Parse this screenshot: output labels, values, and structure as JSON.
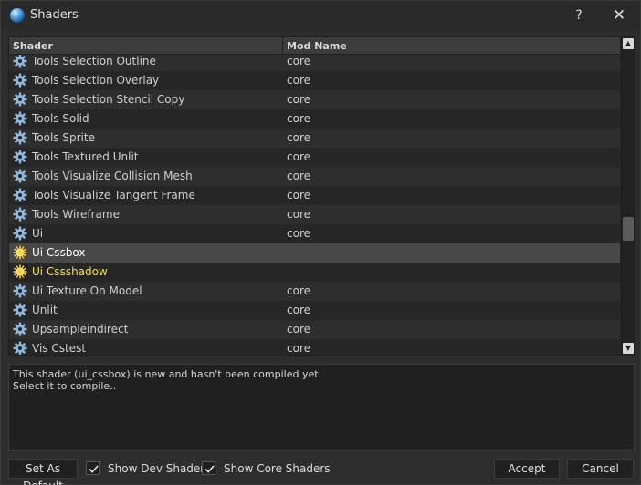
{
  "window": {
    "title": "Shaders",
    "help_label": "?",
    "close_label": "✕"
  },
  "table": {
    "columns": [
      "Shader",
      "Mod Name"
    ],
    "rows": [
      {
        "name": "Tools Selection Outline",
        "mod": "core",
        "icon": "gear-icon",
        "state": "normal"
      },
      {
        "name": "Tools Selection Overlay",
        "mod": "core",
        "icon": "gear-icon",
        "state": "normal"
      },
      {
        "name": "Tools Selection Stencil Copy",
        "mod": "core",
        "icon": "gear-icon",
        "state": "normal"
      },
      {
        "name": "Tools Solid",
        "mod": "core",
        "icon": "gear-icon",
        "state": "normal"
      },
      {
        "name": "Tools Sprite",
        "mod": "core",
        "icon": "gear-icon",
        "state": "normal"
      },
      {
        "name": "Tools Textured Unlit",
        "mod": "core",
        "icon": "gear-icon",
        "state": "normal"
      },
      {
        "name": "Tools Visualize Collision Mesh",
        "mod": "core",
        "icon": "gear-icon",
        "state": "normal"
      },
      {
        "name": "Tools Visualize Tangent Frame",
        "mod": "core",
        "icon": "gear-icon",
        "state": "normal"
      },
      {
        "name": "Tools Wireframe",
        "mod": "core",
        "icon": "gear-icon",
        "state": "normal"
      },
      {
        "name": "Ui",
        "mod": "core",
        "icon": "gear-icon",
        "state": "normal"
      },
      {
        "name": "Ui Cssbox",
        "mod": "",
        "icon": "new-shader-icon",
        "state": "selected"
      },
      {
        "name": "Ui Cssshadow",
        "mod": "",
        "icon": "new-shader-icon",
        "state": "highlight"
      },
      {
        "name": "Ui Texture On Model",
        "mod": "core",
        "icon": "gear-icon",
        "state": "normal"
      },
      {
        "name": "Unlit",
        "mod": "core",
        "icon": "gear-icon",
        "state": "normal"
      },
      {
        "name": "Upsampleindirect",
        "mod": "core",
        "icon": "gear-icon",
        "state": "normal"
      },
      {
        "name": "Vis Cstest",
        "mod": "core",
        "icon": "gear-icon",
        "state": "normal"
      }
    ]
  },
  "message": {
    "line1": "This shader (ui_cssbox) is new and hasn't been compiled yet.",
    "line2": "Select it to compile.."
  },
  "footer": {
    "set_default_label": "Set As Default",
    "show_dev_label": "Show Dev Shaders",
    "show_dev_checked": true,
    "show_core_label": "Show Core Shaders",
    "show_core_checked": true,
    "accept_label": "Accept",
    "cancel_label": "Cancel"
  },
  "colors": {
    "selected_row": "#484848",
    "highlight_text": "#f3e23f",
    "gear": "#8fb6dc",
    "new_shader": "#f2c230"
  }
}
